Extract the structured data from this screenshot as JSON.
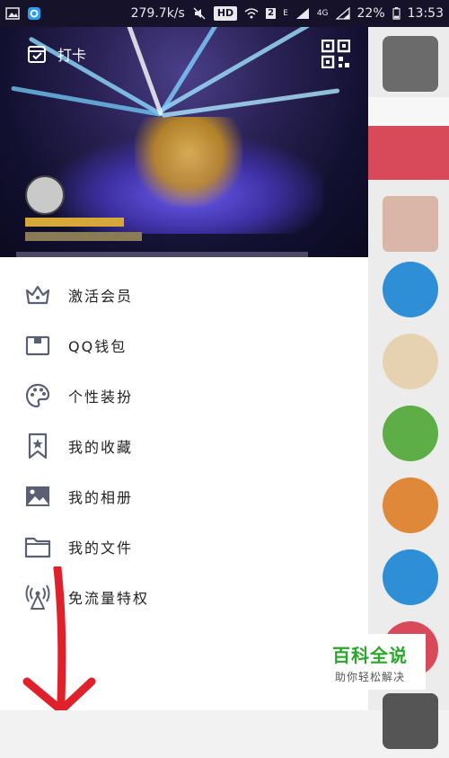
{
  "status_bar": {
    "net_speed": "279.7k/s",
    "hd_label": "HD",
    "sim_label": "2",
    "sig_e": "E",
    "net_4g": "4G",
    "battery": "22%",
    "time": "13:53"
  },
  "drawer": {
    "checkin_label": "打卡",
    "menu": [
      {
        "label": "激活会员",
        "icon": "crown-icon"
      },
      {
        "label": "QQ钱包",
        "icon": "wallet-icon"
      },
      {
        "label": "个性装扮",
        "icon": "palette-icon"
      },
      {
        "label": "我的收藏",
        "icon": "bookmark-star-icon"
      },
      {
        "label": "我的相册",
        "icon": "photo-icon"
      },
      {
        "label": "我的文件",
        "icon": "folder-icon"
      },
      {
        "label": "免流量特权",
        "icon": "antenna-icon"
      }
    ]
  },
  "watermark": {
    "title": "百科全说",
    "subtitle": "助你轻松解决"
  },
  "colors": {
    "icon": "#5a5f73",
    "header_bg": "#16122a",
    "arrow": "#e0202a",
    "watermark_green": "#2aa62a"
  }
}
